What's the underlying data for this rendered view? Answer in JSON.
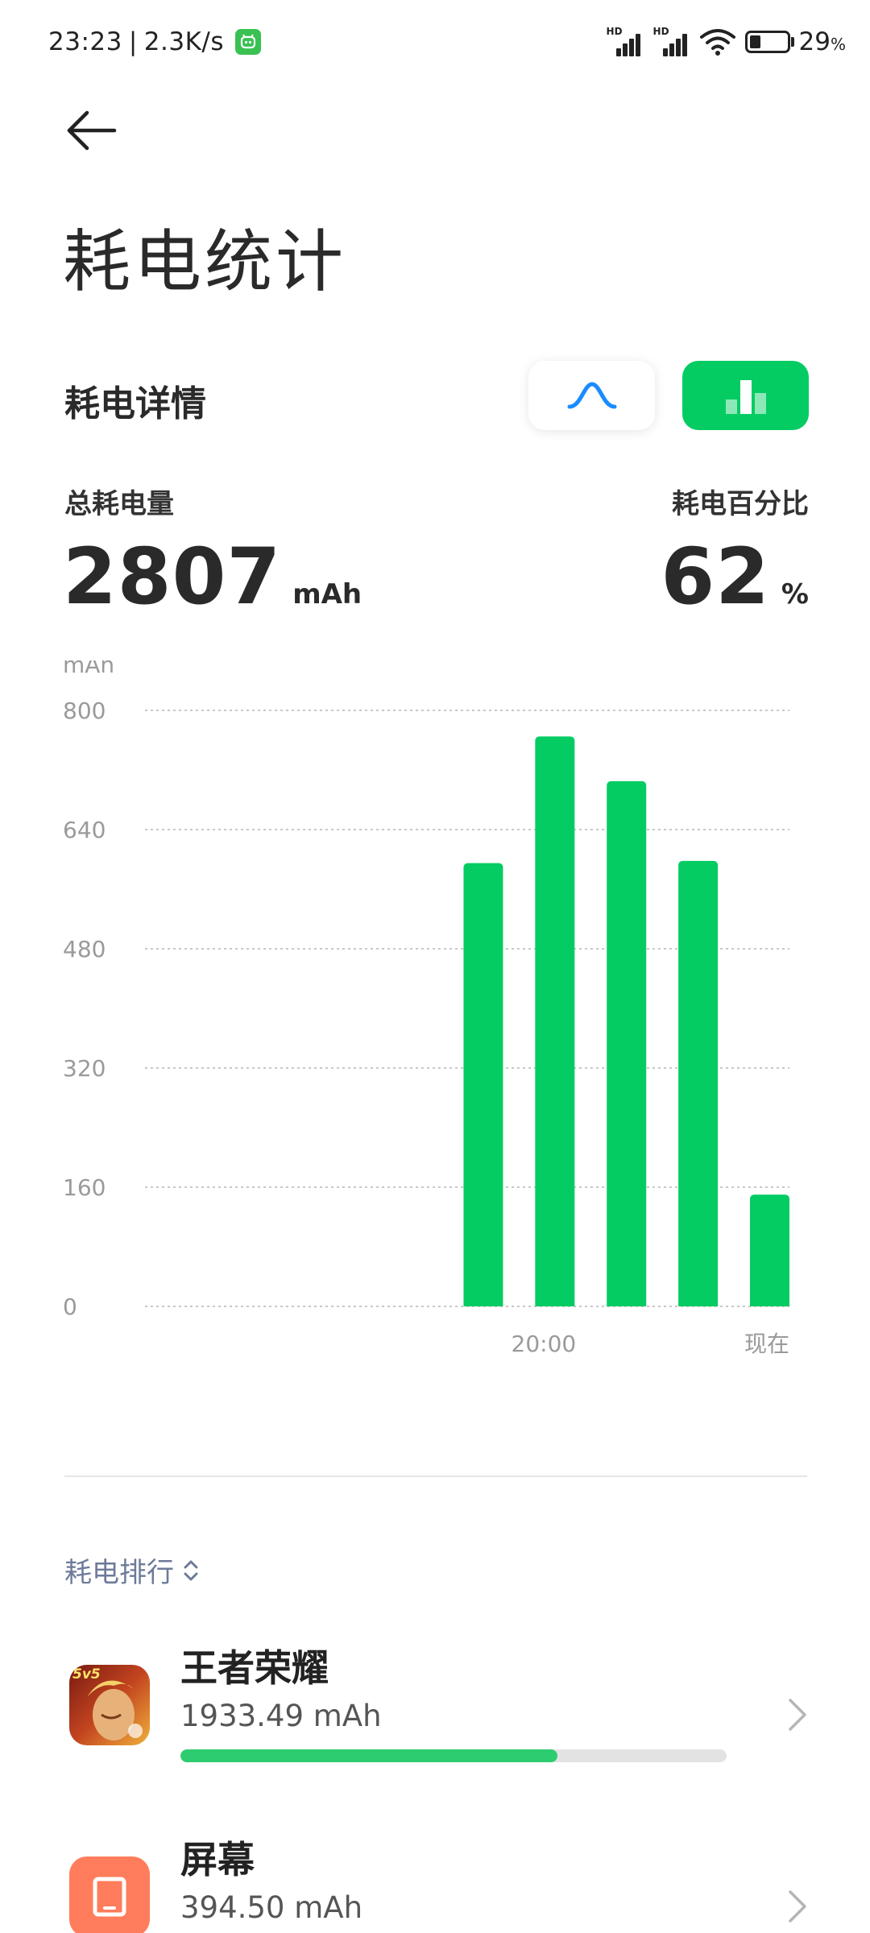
{
  "status_bar": {
    "time": "23:23",
    "separator": "|",
    "net_speed": "2.3K/s",
    "sim1_tag": "HD",
    "sim2_tag": "HD",
    "battery_value": "29",
    "battery_unit": "%",
    "battery_level": 0.29,
    "icons": [
      "app-notification-icon",
      "signal-icon",
      "signal-icon",
      "wifi-icon",
      "battery-icon"
    ]
  },
  "header": {
    "back_icon": "arrow-left-icon",
    "title": "耗电统计"
  },
  "details": {
    "title": "耗电详情",
    "toggle_line_icon": "line-chart-icon",
    "toggle_bar_icon": "bar-chart-icon",
    "selected_view": "bar",
    "total_label": "总耗电量",
    "total_value": "2807",
    "total_unit": "mAh",
    "percent_label": "耗电百分比",
    "percent_value": "62",
    "percent_unit": "%"
  },
  "chart_data": {
    "type": "bar",
    "title": "",
    "xlabel": "",
    "ylabel": "mAh",
    "ylim": [
      0,
      800
    ],
    "yticks": [
      "800",
      "640",
      "480",
      "320",
      "160",
      "0"
    ],
    "x_tick_labels": [
      {
        "slot": 6,
        "label": "20:00"
      },
      {
        "slot": 9,
        "label": "现在"
      }
    ],
    "slots": 9,
    "values": [
      0,
      0,
      0,
      0,
      595,
      765,
      705,
      598,
      150
    ],
    "grid": true,
    "color": "#04cc63"
  },
  "ranking": {
    "label": "耗电排行",
    "sort_icon": "sort-updown-icon",
    "items": [
      {
        "name": "王者荣耀",
        "value": "1933.49 mAh",
        "share": 0.69,
        "icon": "game-app-icon",
        "icon_text": "5v5"
      },
      {
        "name": "屏幕",
        "value": "394.50 mAh",
        "share": 0.14,
        "icon": "screen-icon"
      }
    ]
  },
  "colors": {
    "accent_green": "#04cc63",
    "progress_green": "#2ecc71",
    "line_icon_blue": "#1a8cff",
    "rank_label": "#6d7a99",
    "screen_icon_bg": "#ff7d5c"
  }
}
